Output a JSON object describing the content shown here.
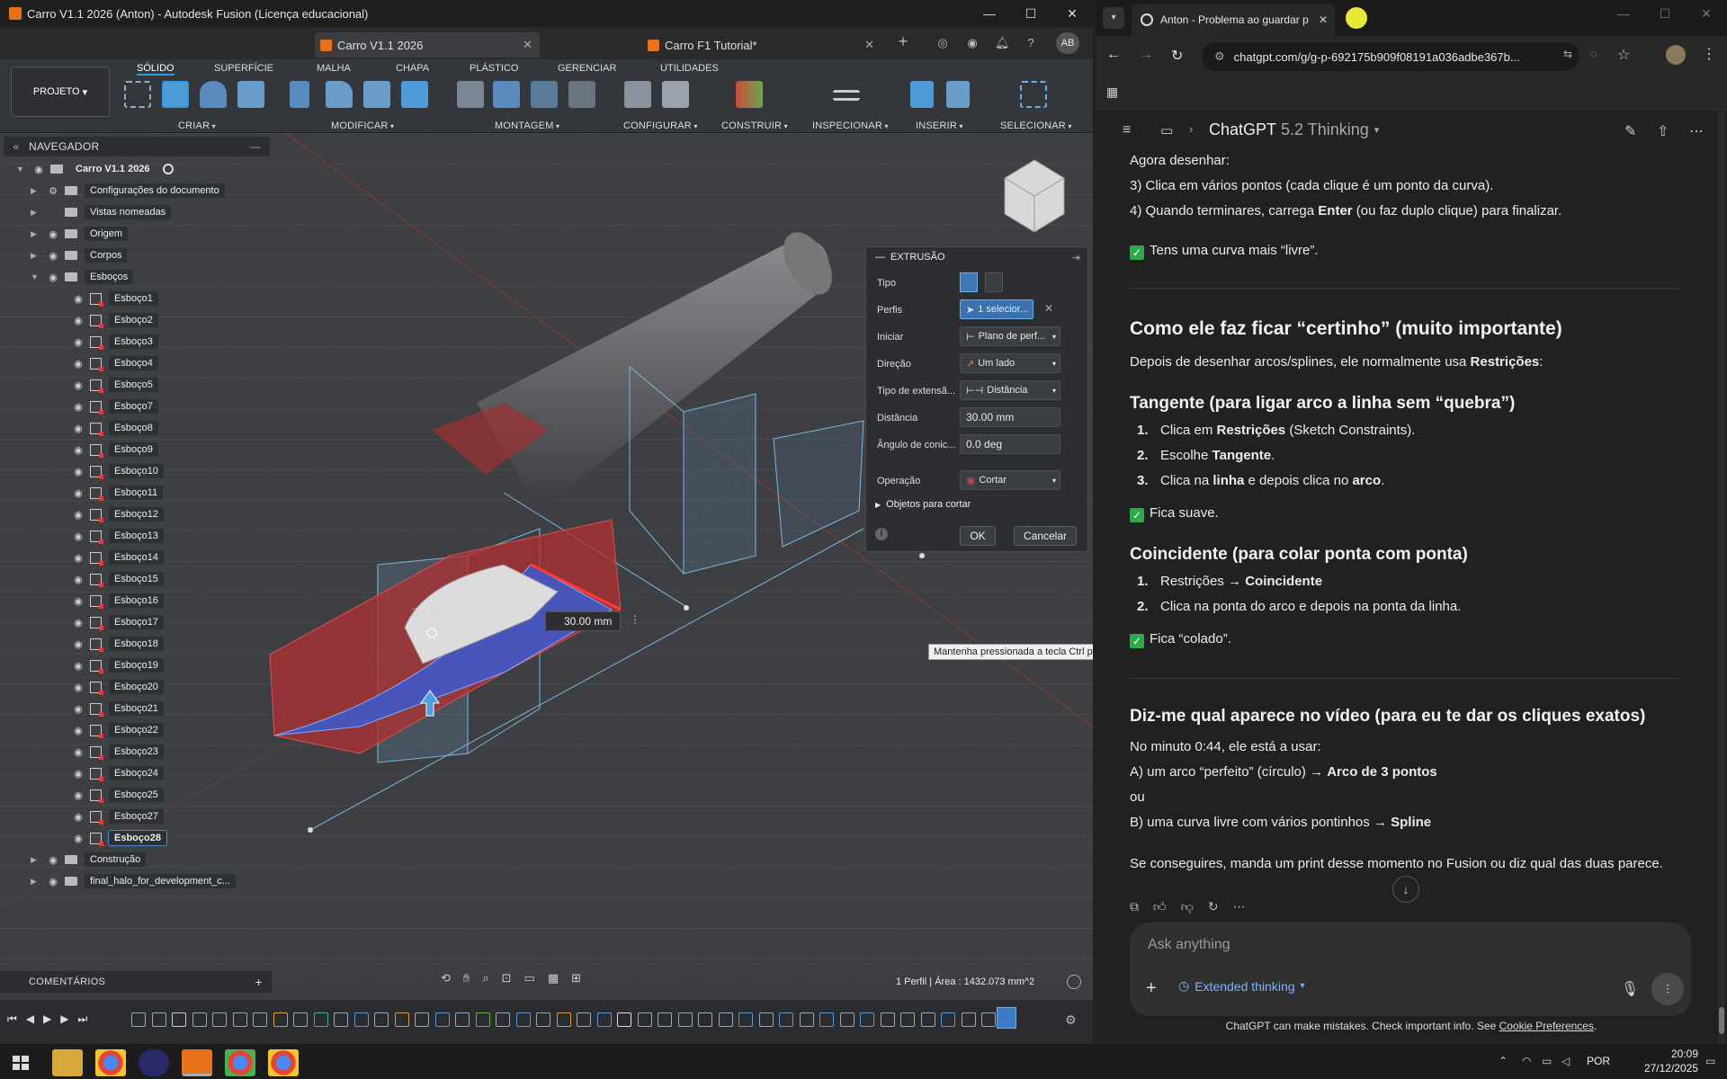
{
  "fusion": {
    "window_title": "Carro V1.1 2026 (Anton) - Autodesk Fusion (Licença educacional)",
    "tabs": [
      {
        "label": "Carro V1.1 2026",
        "active": true
      },
      {
        "label": "Carro F1 Tutorial*",
        "active": false
      }
    ],
    "user_initials": "AB",
    "projeto_label": "PROJETO",
    "ribbon_tabs": [
      "SÓLIDO",
      "SUPERFÍCIE",
      "MALHA",
      "CHAPA",
      "PLÁSTICO",
      "GERENCIAR",
      "UTILIDADES"
    ],
    "ribbon_groups": [
      "CRIAR",
      "MODIFICAR",
      "MONTAGEM",
      "CONFIGURAR",
      "CONSTRUIR",
      "INSPECIONAR",
      "INSERIR",
      "SELECIONAR"
    ],
    "navigator": {
      "title": "NAVEGADOR",
      "root": "Carro V1.1 2026",
      "items": [
        "Configurações do documento",
        "Vistas nomeadas",
        "Origem",
        "Corpos",
        "Esboços"
      ],
      "sketches": [
        "Esboço1",
        "Esboço2",
        "Esboço3",
        "Esboço4",
        "Esboço5",
        "Esboço7",
        "Esboço8",
        "Esboço9",
        "Esboço10",
        "Esboço11",
        "Esboço12",
        "Esboço13",
        "Esboço14",
        "Esboço15",
        "Esboço16",
        "Esboço17",
        "Esboço18",
        "Esboço19",
        "Esboço20",
        "Esboço21",
        "Esboço22",
        "Esboço23",
        "Esboço24",
        "Esboço25",
        "Esboço27",
        "Esboço28"
      ],
      "after": [
        "Construção",
        "final_halo_for_development_c..."
      ]
    },
    "extrude": {
      "title": "EXTRUSÃO",
      "labels": {
        "tipo": "Tipo",
        "perfis": "Perfis",
        "iniciar": "Iniciar",
        "direcao": "Direção",
        "tipo_ext": "Tipo de extensã...",
        "distancia": "Distância",
        "angulo": "Ângulo de conic...",
        "operacao": "Operação"
      },
      "perfis_value": "1 selecior...",
      "iniciar_value": "Plano de perf...",
      "direcao_value": "Um lado",
      "tipo_ext_value": "Distância",
      "distancia_value": "30.00 mm",
      "angulo_value": "0.0 deg",
      "operacao_value": "Cortar",
      "objetos": "Objetos para cortar",
      "ok": "OK",
      "cancel": "Cancelar"
    },
    "viewport": {
      "dim_label": "30.00 mm",
      "dim_ghost": "30.00",
      "tooltip": "Mantenha pressionada a tecla Ctrl para modificar a seleção"
    },
    "comments": "COMENTÁRIOS",
    "status": "1 Perfil | Área : 1432.073 mm^2"
  },
  "chrome": {
    "tab_title": "Anton - Problema ao guardar p",
    "url": "chatgpt.com/g/g-p-692175b909f08191a036adbe367b...",
    "model": "ChatGPT",
    "model_version": "5.2 Thinking",
    "content": {
      "p1": "Agora desenhar:",
      "p2": "3) Clica em vários pontos (cada clique é um ponto da curva).",
      "p3a": "4) Quando terminares, carrega ",
      "p3b": "Enter",
      "p3c": " (ou faz duplo clique) para finalizar.",
      "p4": "Tens uma curva mais “livre”.",
      "h2a": "Como ele faz ficar “certinho” (muito importante)",
      "p5a": "Depois de desenhar arcos/splines, ele normalmente usa ",
      "p5b": "Restrições",
      "p5c": ":",
      "h3a": "Tangente (para ligar arco a linha sem “quebra”)",
      "l1a": "Clica em ",
      "l1b": "Restrições",
      "l1c": " (Sketch Constraints).",
      "l2a": "Escolhe ",
      "l2b": "Tangente",
      "l2c": ".",
      "l3a": "Clica na ",
      "l3b": "linha",
      "l3c": " e depois clica no ",
      "l3d": "arco",
      "l3e": ".",
      "p6": "Fica suave.",
      "h3b": "Coincidente (para colar ponta com ponta)",
      "l4a": "Restrições → ",
      "l4b": "Coincidente",
      "l5": "Clica na ponta do arco e depois na ponta da linha.",
      "p7": "Fica “colado”.",
      "h2b": "Diz-me qual aparece no vídeo (para eu te dar os cliques exatos)",
      "p8": "No minuto 0:44, ele está a usar:",
      "p9a": "A) um arco “perfeito” (círculo) → ",
      "p9b": "Arco de 3 pontos",
      "p10": "ou",
      "p11a": "B) uma curva livre com vários pontinhos → ",
      "p11b": "Spline",
      "p12": "Se conseguires, manda um print desse momento no Fusion ou diz qual das duas parece."
    },
    "composer_placeholder": "Ask anything",
    "extended_thinking": "Extended thinking",
    "disclaimer_a": "ChatGPT can make mistakes. Check important info. See ",
    "disclaimer_b": "Cookie Preferences",
    "disclaimer_c": "."
  },
  "taskbar": {
    "lang": "POR",
    "time": "20:09",
    "date": "27/12/2025"
  }
}
